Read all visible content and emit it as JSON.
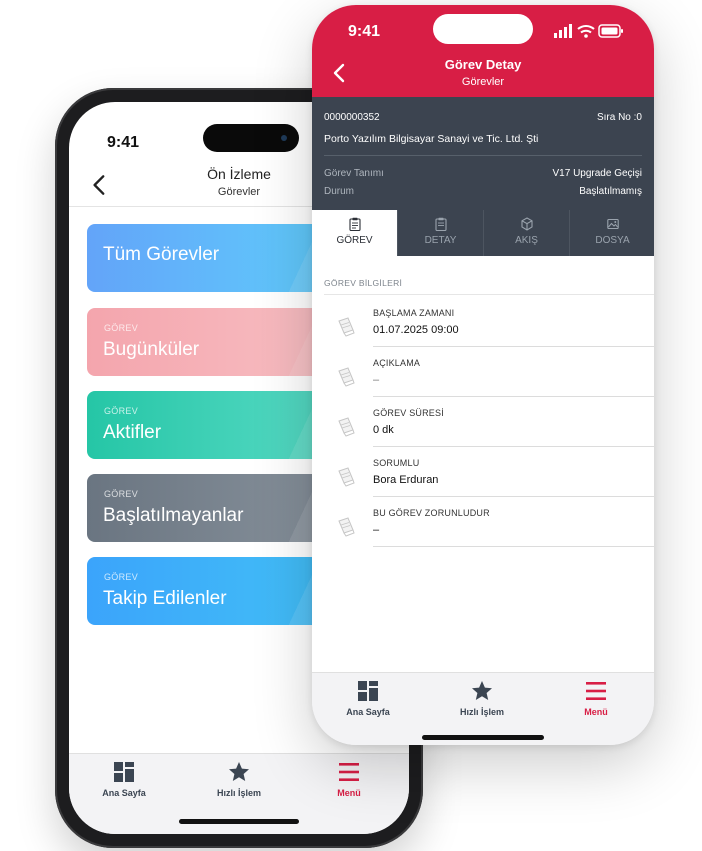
{
  "back_phone": {
    "time": "9:41",
    "header": {
      "title": "Ön İzleme",
      "subtitle": "Görevler"
    },
    "cards": [
      {
        "kicker": "",
        "label": "Tüm Görevler"
      },
      {
        "kicker": "GÖREV",
        "label": "Bugünküler"
      },
      {
        "kicker": "GÖREV",
        "label": "Aktifler"
      },
      {
        "kicker": "GÖREV",
        "label": "Başlatılmayanlar"
      },
      {
        "kicker": "GÖREV",
        "label": "Takip Edilenler"
      }
    ],
    "tabbar": [
      {
        "label": "Ana Sayfa",
        "icon": "grid-icon"
      },
      {
        "label": "Hızlı İşlem",
        "icon": "star-icon"
      },
      {
        "label": "Menü",
        "icon": "menu-icon"
      }
    ]
  },
  "front_phone": {
    "time": "9:41",
    "header": {
      "title": "Görev Detay",
      "subtitle": "Görevler"
    },
    "info": {
      "code": "0000000352",
      "sira": "Sıra No :0",
      "company": "Porto Yazılım Bilgisayar Sanayi ve Tic. Ltd. Şti",
      "rows": [
        {
          "key": "Görev Tanımı",
          "value": "V17 Upgrade Geçişi"
        },
        {
          "key": "Durum",
          "value": "Başlatılmamış"
        }
      ]
    },
    "tabs": [
      {
        "label": "GÖREV",
        "icon": "clipboard-icon"
      },
      {
        "label": "DETAY",
        "icon": "clipboard-icon"
      },
      {
        "label": "AKIŞ",
        "icon": "box-icon"
      },
      {
        "label": "DOSYA",
        "icon": "image-icon"
      }
    ],
    "section_title": "GÖREV BİLGİLERİ",
    "fields": [
      {
        "label": "BAŞLAMA ZAMANI",
        "value": "01.07.2025 09:00"
      },
      {
        "label": "AÇIKLAMA",
        "value": "–"
      },
      {
        "label": "GÖREV SÜRESİ",
        "value": "0 dk"
      },
      {
        "label": "SORUMLU",
        "value": "Bora Erduran"
      },
      {
        "label": "BU GÖREV ZORUNLUDUR",
        "value": "–"
      }
    ],
    "tabbar": [
      {
        "label": "Ana Sayfa",
        "icon": "grid-icon"
      },
      {
        "label": "Hızlı İşlem",
        "icon": "star-icon"
      },
      {
        "label": "Menü",
        "icon": "menu-icon"
      }
    ]
  },
  "colors": {
    "brand_red": "#d81e45",
    "panel_dark": "#3c4450",
    "tab_inactive": "#3b4552"
  }
}
